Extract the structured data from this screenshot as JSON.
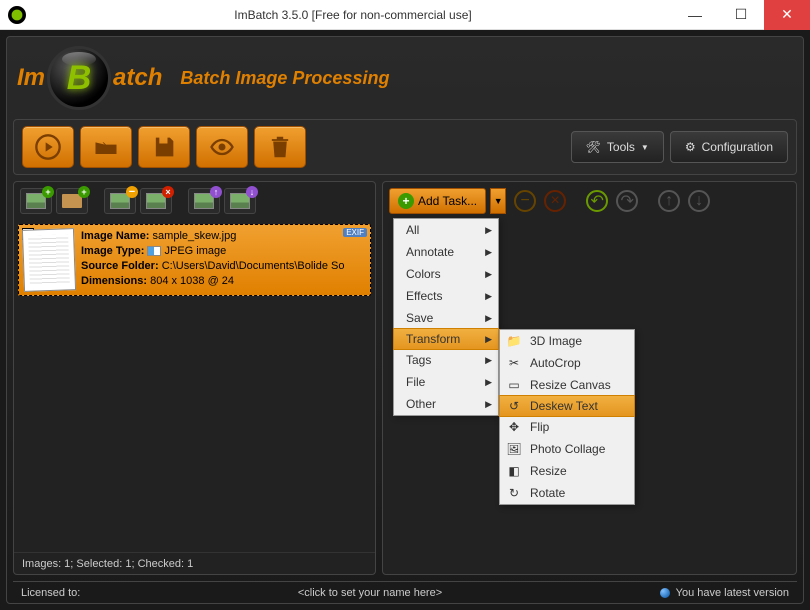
{
  "titlebar": {
    "app_icon_letter": "B",
    "title": "ImBatch 3.5.0 [Free for non-commercial use]"
  },
  "header": {
    "logo_im": "Im",
    "logo_b": "B",
    "logo_atch": "atch",
    "subtitle": "Batch Image Processing"
  },
  "top_toolbar": {
    "tools_label": "Tools",
    "config_label": "Configuration"
  },
  "right_toolbar": {
    "add_task_label": "Add Task..."
  },
  "image": {
    "name_label": "Image Name:",
    "name_value": "sample_skew.jpg",
    "type_label": "Image Type:",
    "type_value": "JPEG image",
    "folder_label": "Source Folder:",
    "folder_value": "C:\\Users\\David\\Documents\\Bolide So",
    "dim_label": "Dimensions:",
    "dim_value": "804 x 1038 @ 24",
    "exif": "EXIF"
  },
  "left_footer": "Images: 1; Selected: 1; Checked: 1",
  "menu": {
    "items": [
      "All",
      "Annotate",
      "Colors",
      "Effects",
      "Save",
      "Transform",
      "Tags",
      "File",
      "Other"
    ],
    "highlighted": "Transform"
  },
  "submenu": {
    "items": [
      {
        "label": "3D Image",
        "icon": "📁"
      },
      {
        "label": "AutoCrop",
        "icon": "✂"
      },
      {
        "label": "Resize Canvas",
        "icon": "▭"
      },
      {
        "label": "Deskew Text",
        "icon": "↺"
      },
      {
        "label": "Flip",
        "icon": "✥"
      },
      {
        "label": "Photo Collage",
        "icon": "🖼"
      },
      {
        "label": "Resize",
        "icon": "◧"
      },
      {
        "label": "Rotate",
        "icon": "↻"
      }
    ],
    "highlighted": "Deskew Text"
  },
  "status": {
    "licensed": "Licensed to:",
    "name_hint": "<click to set your name here>",
    "version": "You have latest version"
  }
}
